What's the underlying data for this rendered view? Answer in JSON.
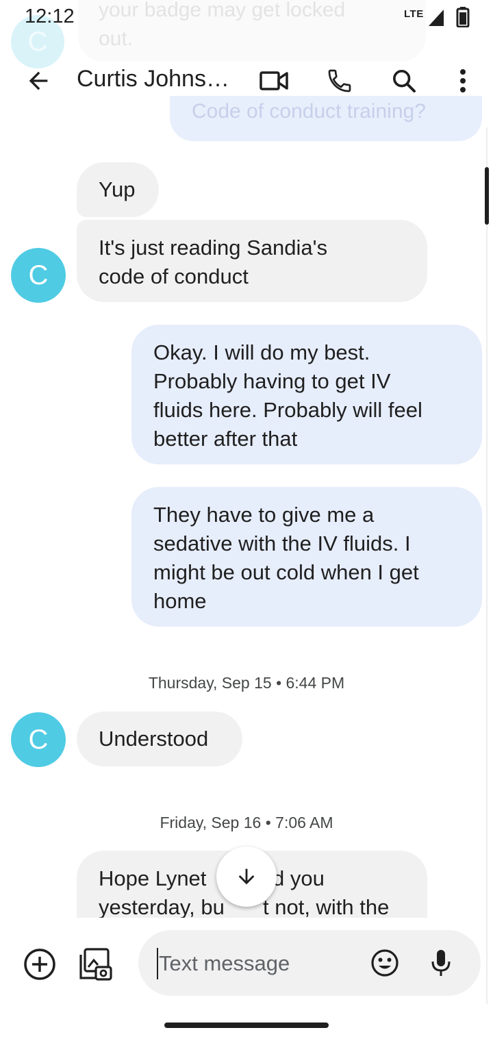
{
  "status_bar": {
    "time": "12:12",
    "network": "LTE"
  },
  "header": {
    "contact_name": "Curtis Johns…",
    "avatar_initial": "C"
  },
  "ghost": {
    "line1": "your badge may get locked",
    "line2": "out.",
    "outgoing_text": "Code of conduct training?"
  },
  "messages": [
    {
      "direction": "incoming",
      "text": "Yup"
    },
    {
      "direction": "incoming",
      "lines": [
        "It's just reading Sandia's",
        "code of conduct"
      ]
    },
    {
      "direction": "outgoing",
      "lines": [
        "Okay. I will do my best.",
        "Probably having to get IV",
        "fluids here. Probably will feel",
        "better after that"
      ]
    },
    {
      "direction": "outgoing",
      "lines": [
        "They have to give me a",
        "sedative with the IV fluids. I",
        "might be out cold when I get",
        "home"
      ]
    },
    {
      "type": "date",
      "text": "Thursday, Sep 15 • 6:44 PM"
    },
    {
      "direction": "incoming",
      "text": "Understood"
    },
    {
      "type": "date",
      "text": "Friday, Sep 16 • 7:06 AM"
    },
    {
      "direction": "incoming",
      "lines": [
        "Hope Lynet",
        "d you",
        "yesterday, bu",
        "t not, with the"
      ]
    }
  ],
  "compose": {
    "placeholder": "Text message"
  },
  "colors": {
    "avatar": "#4fcbe4",
    "incoming_bubble": "#f1f1f1",
    "outgoing_bubble": "#e6edfb"
  }
}
